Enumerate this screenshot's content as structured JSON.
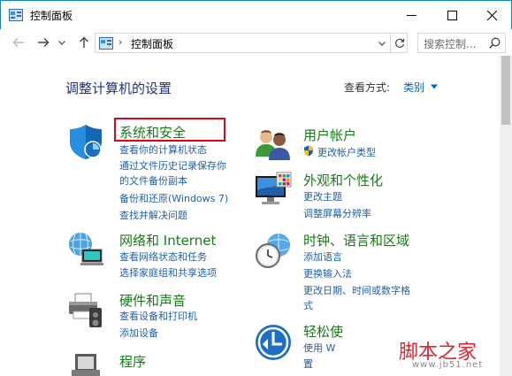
{
  "window": {
    "title": "控制面板"
  },
  "nav": {
    "address": "控制面板",
    "address_sep": "›",
    "search_placeholder": "搜索控制...",
    "search_value": ""
  },
  "main": {
    "heading": "调整计算机的设置",
    "view_by_label": "查看方式:",
    "view_by_value": "类别"
  },
  "categories": [
    {
      "title": "系统和安全",
      "icon": "shield-icon",
      "links": [
        "查看你的计算机状态",
        "通过文件历史记录保存你",
        "的文件备份副本",
        "备份和还原(Windows 7)",
        "查找并解决问题"
      ]
    },
    {
      "title": "网络和 Internet",
      "icon": "network-icon",
      "links": [
        "查看网络状态和任务",
        "选择家庭组和共享选项"
      ]
    },
    {
      "title": "硬件和声音",
      "icon": "printer-icon",
      "links": [
        "查看设备和打印机",
        "添加设备"
      ]
    },
    {
      "title": "程序",
      "icon": "programs-icon",
      "links": []
    },
    {
      "title": "用户帐户",
      "icon": "users-icon",
      "links": [
        "更改帐户类型"
      ]
    },
    {
      "title": "外观和个性化",
      "icon": "monitor-icon",
      "links": [
        "更改主题",
        "调整屏幕分辨率"
      ]
    },
    {
      "title": "时钟、语言和区域",
      "icon": "clock-globe-icon",
      "links": [
        "添加语言",
        "更换输入法",
        "更改日期、时间或数字格",
        "式"
      ]
    },
    {
      "title": "轻松使",
      "icon": "ease-of-access-icon",
      "links": [
        "使用 W",
        "置"
      ]
    }
  ],
  "watermark": {
    "main": "脚本之家",
    "sub": "www.jb51.net"
  },
  "colors": {
    "category_title": "#177a17",
    "link": "#1f5fa8",
    "heading": "#1e3287",
    "highlight": "#e60012"
  }
}
